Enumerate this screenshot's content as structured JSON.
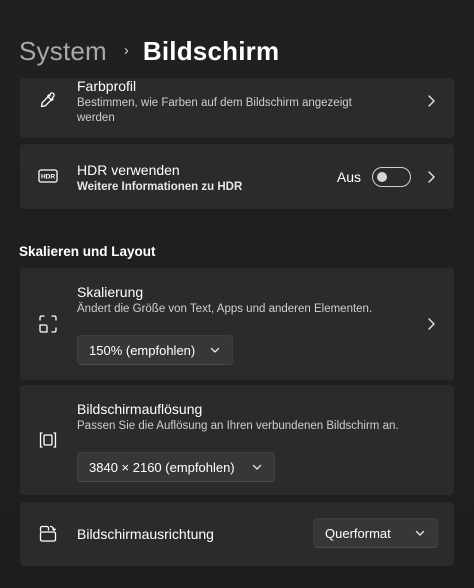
{
  "breadcrumb": {
    "parent": "System",
    "separator": "›",
    "current": "Bildschirm"
  },
  "cards": {
    "color_profile": {
      "title": "Farbprofil",
      "desc_line1": "Bestimmen, wie Farben auf dem Bildschirm angezeigt",
      "desc_line2": "werden",
      "icon": "eyedropper-icon"
    },
    "hdr": {
      "title": "HDR verwenden",
      "desc": "Weitere Informationen zu HDR",
      "state_label": "Aus",
      "toggle_on": false,
      "icon": "hdr-icon"
    }
  },
  "section": {
    "title": "Skalieren und Layout"
  },
  "scaling": {
    "title": "Skalierung",
    "desc": "Ändert die Größe von Text, Apps und anderen Elementen.",
    "selected": "150% (empfohlen)",
    "icon": "scale-icon"
  },
  "resolution": {
    "title": "Bildschirmauflösung",
    "desc": "Passen Sie die Auflösung an Ihren verbundenen Bildschirm an.",
    "selected": "3840 × 2160 (empfohlen)",
    "icon": "resolution-icon"
  },
  "orientation": {
    "title": "Bildschirmausrichtung",
    "selected": "Querformat",
    "icon": "orientation-icon"
  },
  "colors": {
    "card_bg": "#2b2b2b",
    "page_bg": "#1f2120",
    "muted_text": "#cfcfcf"
  }
}
